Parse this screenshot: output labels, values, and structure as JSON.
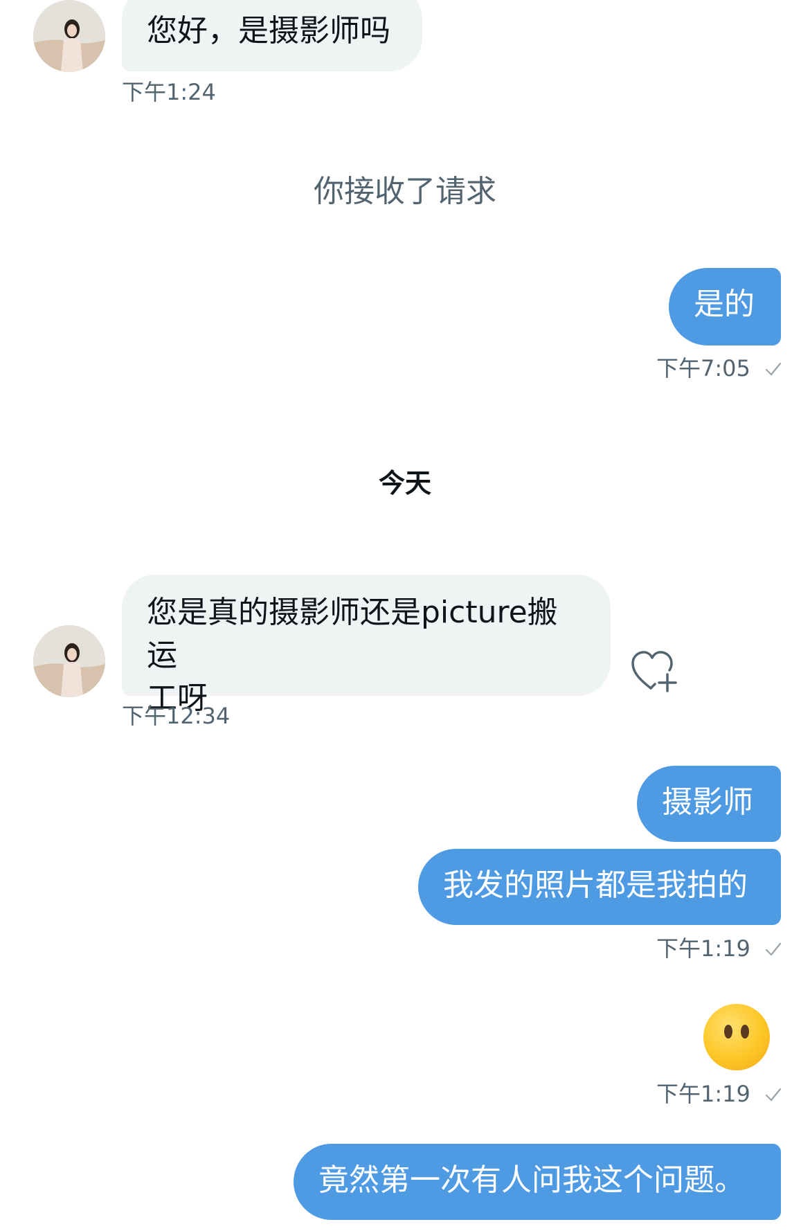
{
  "messages": {
    "m1": {
      "text": "您好，是摄影师吗",
      "time": "下午1:24"
    },
    "system": {
      "text": "你接收了请求"
    },
    "m2": {
      "text": "是的",
      "time": "下午7:05"
    },
    "day_separator": "今天",
    "m3": {
      "line1": "您是真的摄影师还是picture搬运",
      "line2": "工呀",
      "time": "下午12:34"
    },
    "m4": {
      "text": "摄影师"
    },
    "m5": {
      "text": "我发的照片都是我拍的",
      "time": "下午1:19"
    },
    "m6": {
      "emoji": "neutral-face-without-mouth",
      "time": "下午1:19"
    },
    "m7": {
      "text": "竟然第一次有人问我这个问题。"
    }
  },
  "colors": {
    "sent_bubble": "#4e9be4",
    "received_bubble": "#eff3f4",
    "timestamp": "#536471"
  },
  "icons": {
    "react": "heart-plus-icon",
    "delivered": "checkmark-icon"
  }
}
